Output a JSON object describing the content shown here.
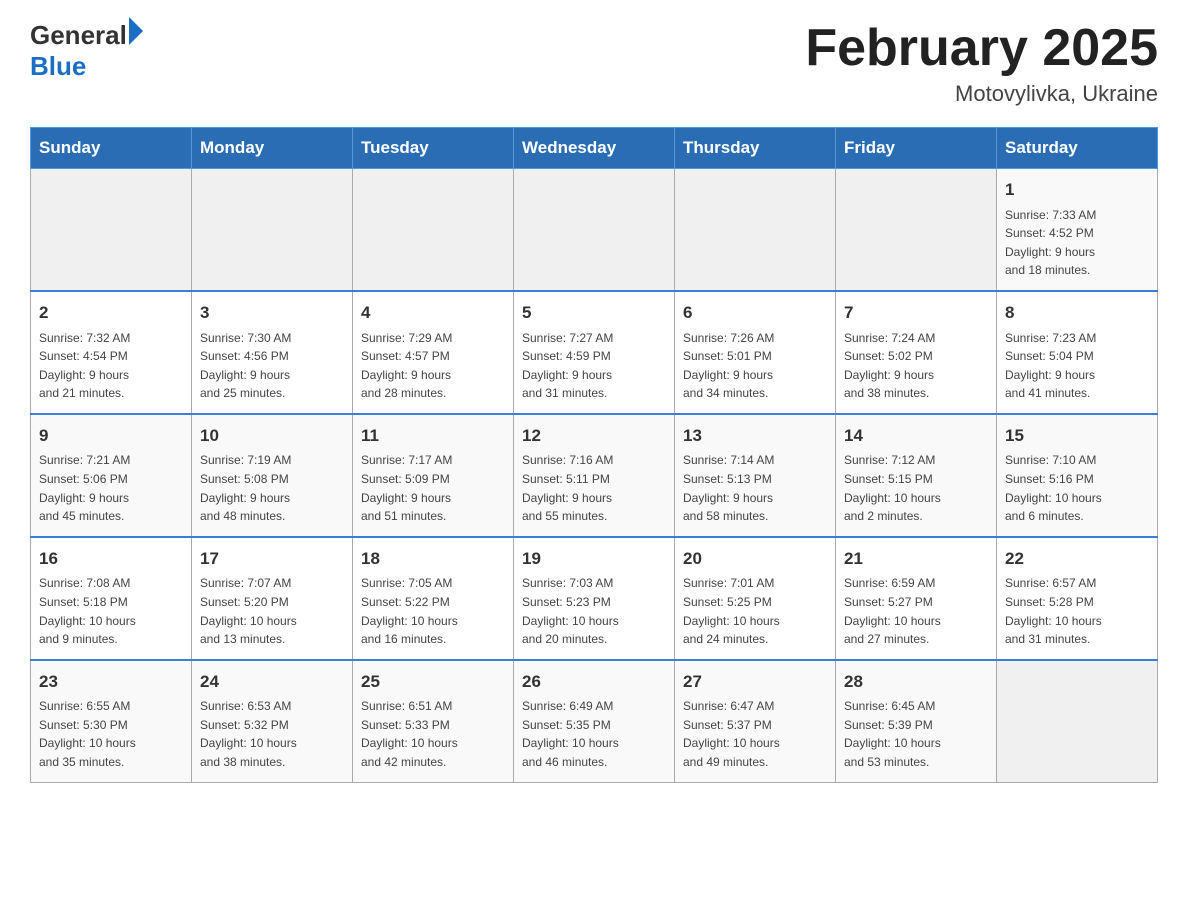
{
  "header": {
    "logo_general": "General",
    "logo_blue": "Blue",
    "month_title": "February 2025",
    "location": "Motovylivka, Ukraine"
  },
  "weekdays": [
    "Sunday",
    "Monday",
    "Tuesday",
    "Wednesday",
    "Thursday",
    "Friday",
    "Saturday"
  ],
  "weeks": [
    {
      "days": [
        {
          "num": "",
          "info": ""
        },
        {
          "num": "",
          "info": ""
        },
        {
          "num": "",
          "info": ""
        },
        {
          "num": "",
          "info": ""
        },
        {
          "num": "",
          "info": ""
        },
        {
          "num": "",
          "info": ""
        },
        {
          "num": "1",
          "info": "Sunrise: 7:33 AM\nSunset: 4:52 PM\nDaylight: 9 hours\nand 18 minutes."
        }
      ]
    },
    {
      "days": [
        {
          "num": "2",
          "info": "Sunrise: 7:32 AM\nSunset: 4:54 PM\nDaylight: 9 hours\nand 21 minutes."
        },
        {
          "num": "3",
          "info": "Sunrise: 7:30 AM\nSunset: 4:56 PM\nDaylight: 9 hours\nand 25 minutes."
        },
        {
          "num": "4",
          "info": "Sunrise: 7:29 AM\nSunset: 4:57 PM\nDaylight: 9 hours\nand 28 minutes."
        },
        {
          "num": "5",
          "info": "Sunrise: 7:27 AM\nSunset: 4:59 PM\nDaylight: 9 hours\nand 31 minutes."
        },
        {
          "num": "6",
          "info": "Sunrise: 7:26 AM\nSunset: 5:01 PM\nDaylight: 9 hours\nand 34 minutes."
        },
        {
          "num": "7",
          "info": "Sunrise: 7:24 AM\nSunset: 5:02 PM\nDaylight: 9 hours\nand 38 minutes."
        },
        {
          "num": "8",
          "info": "Sunrise: 7:23 AM\nSunset: 5:04 PM\nDaylight: 9 hours\nand 41 minutes."
        }
      ]
    },
    {
      "days": [
        {
          "num": "9",
          "info": "Sunrise: 7:21 AM\nSunset: 5:06 PM\nDaylight: 9 hours\nand 45 minutes."
        },
        {
          "num": "10",
          "info": "Sunrise: 7:19 AM\nSunset: 5:08 PM\nDaylight: 9 hours\nand 48 minutes."
        },
        {
          "num": "11",
          "info": "Sunrise: 7:17 AM\nSunset: 5:09 PM\nDaylight: 9 hours\nand 51 minutes."
        },
        {
          "num": "12",
          "info": "Sunrise: 7:16 AM\nSunset: 5:11 PM\nDaylight: 9 hours\nand 55 minutes."
        },
        {
          "num": "13",
          "info": "Sunrise: 7:14 AM\nSunset: 5:13 PM\nDaylight: 9 hours\nand 58 minutes."
        },
        {
          "num": "14",
          "info": "Sunrise: 7:12 AM\nSunset: 5:15 PM\nDaylight: 10 hours\nand 2 minutes."
        },
        {
          "num": "15",
          "info": "Sunrise: 7:10 AM\nSunset: 5:16 PM\nDaylight: 10 hours\nand 6 minutes."
        }
      ]
    },
    {
      "days": [
        {
          "num": "16",
          "info": "Sunrise: 7:08 AM\nSunset: 5:18 PM\nDaylight: 10 hours\nand 9 minutes."
        },
        {
          "num": "17",
          "info": "Sunrise: 7:07 AM\nSunset: 5:20 PM\nDaylight: 10 hours\nand 13 minutes."
        },
        {
          "num": "18",
          "info": "Sunrise: 7:05 AM\nSunset: 5:22 PM\nDaylight: 10 hours\nand 16 minutes."
        },
        {
          "num": "19",
          "info": "Sunrise: 7:03 AM\nSunset: 5:23 PM\nDaylight: 10 hours\nand 20 minutes."
        },
        {
          "num": "20",
          "info": "Sunrise: 7:01 AM\nSunset: 5:25 PM\nDaylight: 10 hours\nand 24 minutes."
        },
        {
          "num": "21",
          "info": "Sunrise: 6:59 AM\nSunset: 5:27 PM\nDaylight: 10 hours\nand 27 minutes."
        },
        {
          "num": "22",
          "info": "Sunrise: 6:57 AM\nSunset: 5:28 PM\nDaylight: 10 hours\nand 31 minutes."
        }
      ]
    },
    {
      "days": [
        {
          "num": "23",
          "info": "Sunrise: 6:55 AM\nSunset: 5:30 PM\nDaylight: 10 hours\nand 35 minutes."
        },
        {
          "num": "24",
          "info": "Sunrise: 6:53 AM\nSunset: 5:32 PM\nDaylight: 10 hours\nand 38 minutes."
        },
        {
          "num": "25",
          "info": "Sunrise: 6:51 AM\nSunset: 5:33 PM\nDaylight: 10 hours\nand 42 minutes."
        },
        {
          "num": "26",
          "info": "Sunrise: 6:49 AM\nSunset: 5:35 PM\nDaylight: 10 hours\nand 46 minutes."
        },
        {
          "num": "27",
          "info": "Sunrise: 6:47 AM\nSunset: 5:37 PM\nDaylight: 10 hours\nand 49 minutes."
        },
        {
          "num": "28",
          "info": "Sunrise: 6:45 AM\nSunset: 5:39 PM\nDaylight: 10 hours\nand 53 minutes."
        },
        {
          "num": "",
          "info": ""
        }
      ]
    }
  ]
}
